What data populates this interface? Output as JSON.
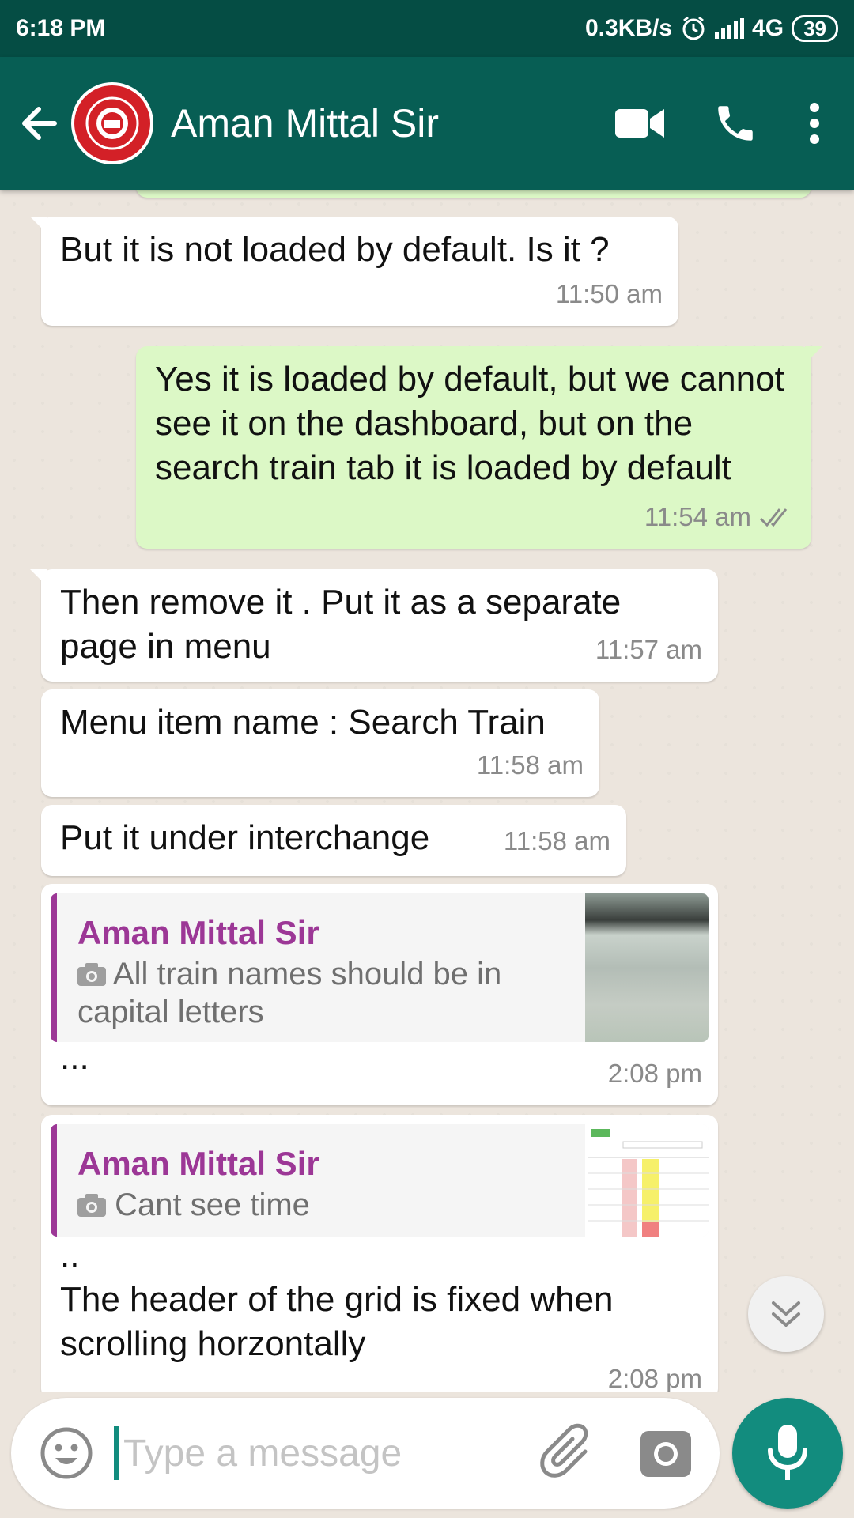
{
  "status_bar": {
    "time": "6:18 PM",
    "speed": "0.3KB/s",
    "network": "4G",
    "battery": "39",
    "icons": [
      "alarm-icon",
      "signal-icon"
    ]
  },
  "header": {
    "contact_name": "Aman Mittal Sir",
    "avatar_icon": "indian-railways-logo",
    "actions": [
      "back-arrow-icon",
      "video-call-icon",
      "voice-call-icon",
      "more-options-icon"
    ]
  },
  "messages": [
    {
      "direction": "in",
      "text": "But it is not loaded by default. Is it ?",
      "time": "11:50 am"
    },
    {
      "direction": "out",
      "text": "Yes it is loaded by default, but we cannot see it on the dashboard, but on the search train tab it is loaded by default",
      "time": "11:54 am",
      "status": "double-check-icon"
    },
    {
      "direction": "in",
      "text": "Then remove it . Put it as a separate page in menu",
      "time": "11:57 am"
    },
    {
      "direction": "in",
      "text": "Menu item name : Search Train",
      "time": "11:58 am"
    },
    {
      "direction": "in",
      "text": "Put it under interchange",
      "time": "11:58 am"
    },
    {
      "direction": "in",
      "quote_author": "Aman Mittal Sir",
      "quote_text": "All train names should be in capital letters",
      "text": "...",
      "time": "2:08 pm"
    },
    {
      "direction": "in",
      "quote_author": "Aman Mittal Sir",
      "quote_text": "Cant see time",
      "text": "..\nThe header of the grid is fixed when scrolling horzontally",
      "time": "2:08 pm"
    }
  ],
  "composer": {
    "placeholder": "Type a message",
    "icons": [
      "emoji-icon",
      "attach-icon",
      "camera-icon",
      "mic-icon"
    ]
  },
  "colors": {
    "status_bar": "#054d44",
    "app_bar": "#075e54",
    "outgoing_bubble": "#dcf8c6",
    "incoming_bubble": "#ffffff",
    "accent": "#128c7e",
    "quote_author": "#9c3796"
  }
}
